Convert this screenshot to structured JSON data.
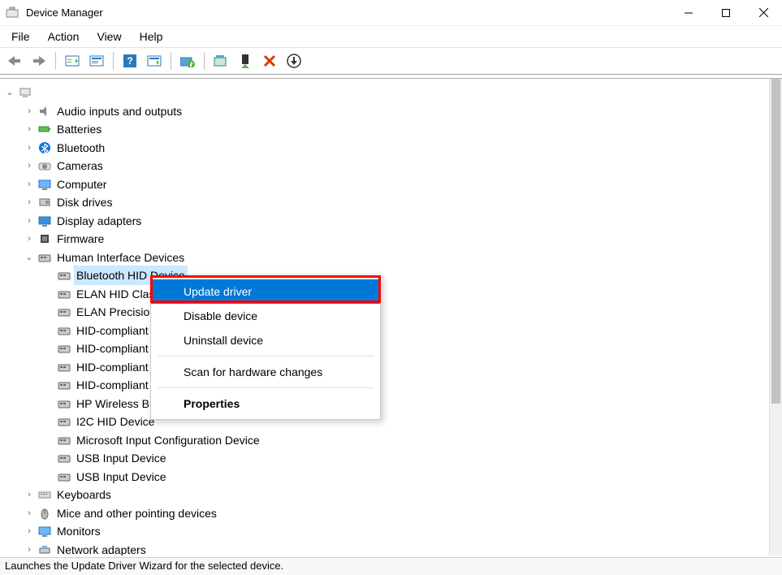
{
  "window": {
    "title": "Device Manager"
  },
  "menubar": {
    "file": "File",
    "action": "Action",
    "view": "View",
    "help": "Help"
  },
  "toolbar": {
    "back": "Back",
    "forward": "Forward",
    "show_hidden": "Show hidden devices",
    "properties": "Properties",
    "help": "Help",
    "refresh": "Refresh",
    "update_driver": "Update driver",
    "disable": "Disable device",
    "uninstall": "Uninstall device",
    "scan": "Scan for hardware changes"
  },
  "tree": {
    "root": "",
    "items": [
      {
        "label": "Audio inputs and outputs",
        "icon": "audio"
      },
      {
        "label": "Batteries",
        "icon": "battery"
      },
      {
        "label": "Bluetooth",
        "icon": "bluetooth"
      },
      {
        "label": "Cameras",
        "icon": "camera"
      },
      {
        "label": "Computer",
        "icon": "computer"
      },
      {
        "label": "Disk drives",
        "icon": "disk"
      },
      {
        "label": "Display adapters",
        "icon": "display"
      },
      {
        "label": "Firmware",
        "icon": "firmware"
      },
      {
        "label": "Human Interface Devices",
        "icon": "hid",
        "expanded": true,
        "children": [
          {
            "label": "Bluetooth HID Device",
            "selected": true
          },
          {
            "label": "ELAN HID Class Filter Driver"
          },
          {
            "label": "ELAN Precision Touchpad Filter Driver"
          },
          {
            "label": "HID-compliant consumer control device"
          },
          {
            "label": "HID-compliant consumer control device"
          },
          {
            "label": "HID-compliant consumer control device"
          },
          {
            "label": "HID-compliant consumer control device"
          },
          {
            "label": "HP Wireless Button Driver"
          },
          {
            "label": "I2C HID Device"
          },
          {
            "label": "Microsoft Input Configuration Device"
          },
          {
            "label": "USB Input Device"
          },
          {
            "label": "USB Input Device"
          }
        ]
      },
      {
        "label": "Keyboards",
        "icon": "keyboard"
      },
      {
        "label": "Mice and other pointing devices",
        "icon": "mouse"
      },
      {
        "label": "Monitors",
        "icon": "monitor"
      },
      {
        "label": "Network adapters",
        "icon": "network"
      }
    ]
  },
  "context_menu": {
    "update_driver": "Update driver",
    "disable_device": "Disable device",
    "uninstall_device": "Uninstall device",
    "scan": "Scan for hardware changes",
    "properties": "Properties"
  },
  "statusbar": {
    "text": "Launches the Update Driver Wizard for the selected device."
  }
}
